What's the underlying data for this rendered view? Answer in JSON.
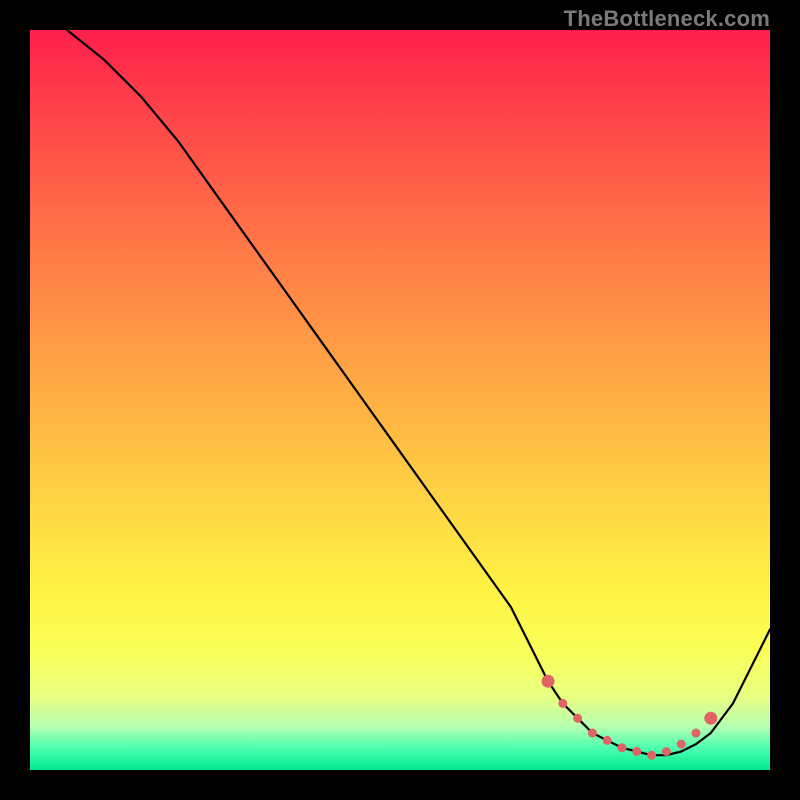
{
  "watermark": "TheBottleneck.com",
  "colors": {
    "background": "#000000",
    "gradient_top": "#ff1e4b",
    "gradient_bottom": "#00e890",
    "curve": "#000000",
    "dots": "#e06464"
  },
  "chart_data": {
    "type": "line",
    "title": "",
    "xlabel": "",
    "ylabel": "",
    "xlim": [
      0,
      100
    ],
    "ylim": [
      0,
      100
    ],
    "grid": false,
    "legend": false,
    "series": [
      {
        "name": "curve",
        "x": [
          5,
          10,
          15,
          20,
          25,
          30,
          35,
          40,
          45,
          50,
          55,
          60,
          65,
          70,
          72,
          74,
          76,
          78,
          80,
          82,
          84,
          86,
          88,
          90,
          92,
          95,
          100
        ],
        "y": [
          100,
          96,
          91,
          85,
          78,
          71,
          64,
          57,
          50,
          43,
          36,
          29,
          22,
          12,
          9,
          7,
          5,
          4,
          3,
          2.5,
          2,
          2,
          2.5,
          3.5,
          5,
          9,
          19
        ]
      }
    ],
    "highlight_points": {
      "name": "markers",
      "x": [
        70,
        72,
        74,
        76,
        78,
        80,
        82,
        84,
        86,
        88,
        90,
        92
      ],
      "y": [
        12,
        9,
        7,
        5,
        4,
        3,
        2.5,
        2,
        2.5,
        3.5,
        5,
        7
      ]
    }
  }
}
